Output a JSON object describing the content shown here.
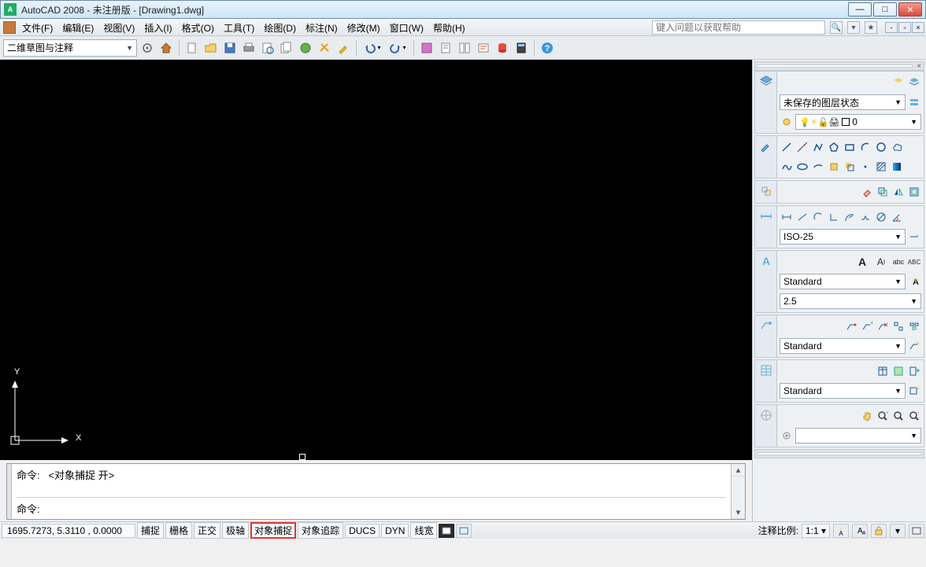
{
  "title": "AutoCAD 2008 - 未注册版 - [Drawing1.dwg]",
  "menu": {
    "file": "文件(F)",
    "edit": "编辑(E)",
    "view": "视图(V)",
    "insert": "插入(I)",
    "format": "格式(O)",
    "tools": "工具(T)",
    "draw": "绘图(D)",
    "dim": "标注(N)",
    "modify": "修改(M)",
    "window": "窗口(W)",
    "help": "帮助(H)"
  },
  "search_placeholder": "键入问题以获取帮助",
  "workspace_combo": "二维草图与注释",
  "panels": {
    "layer_state": "未保存的图层状态",
    "layer_current": "0",
    "dim_style": "ISO-25",
    "text_style": "Standard",
    "text_height": "2.5",
    "leader_style": "Standard",
    "table_style": "Standard"
  },
  "command": {
    "prefix1": "命令:",
    "line1": "<对象捕捉 开>",
    "prefix2": "命令:"
  },
  "ucs": {
    "x": "X",
    "y": "Y"
  },
  "status": {
    "coords": "1695.7273, 5.3110 , 0.0000",
    "snap": "捕捉",
    "grid": "栅格",
    "ortho": "正交",
    "polar": "极轴",
    "osnap": "对象捕捉",
    "otrack": "对象追踪",
    "ducs": "DUCS",
    "dyn": "DYN",
    "lwt": "线宽",
    "anno_label": "注释比例:",
    "anno_scale": "1:1"
  }
}
